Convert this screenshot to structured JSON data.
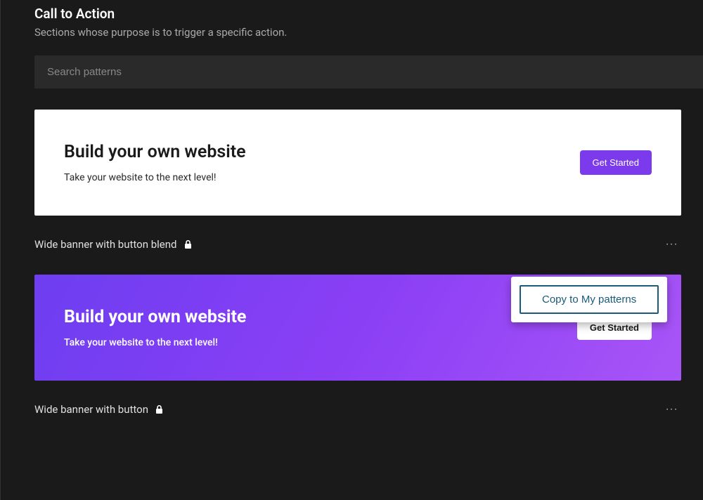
{
  "header": {
    "title": "Call to Action",
    "subtitle": "Sections whose purpose is to trigger a specific action."
  },
  "search": {
    "placeholder": "Search patterns"
  },
  "patterns": [
    {
      "banner_title": "Build your own website",
      "banner_subtitle": "Take your website to the next level!",
      "button_label": "Get Started",
      "label": "Wide banner with button blend"
    },
    {
      "banner_title": "Build your own website",
      "banner_subtitle": "Take your website to the next level!",
      "button_label": "Get Started",
      "label": "Wide banner with button"
    }
  ],
  "popover": {
    "copy_label": "Copy to My patterns"
  },
  "more_glyph": "···"
}
